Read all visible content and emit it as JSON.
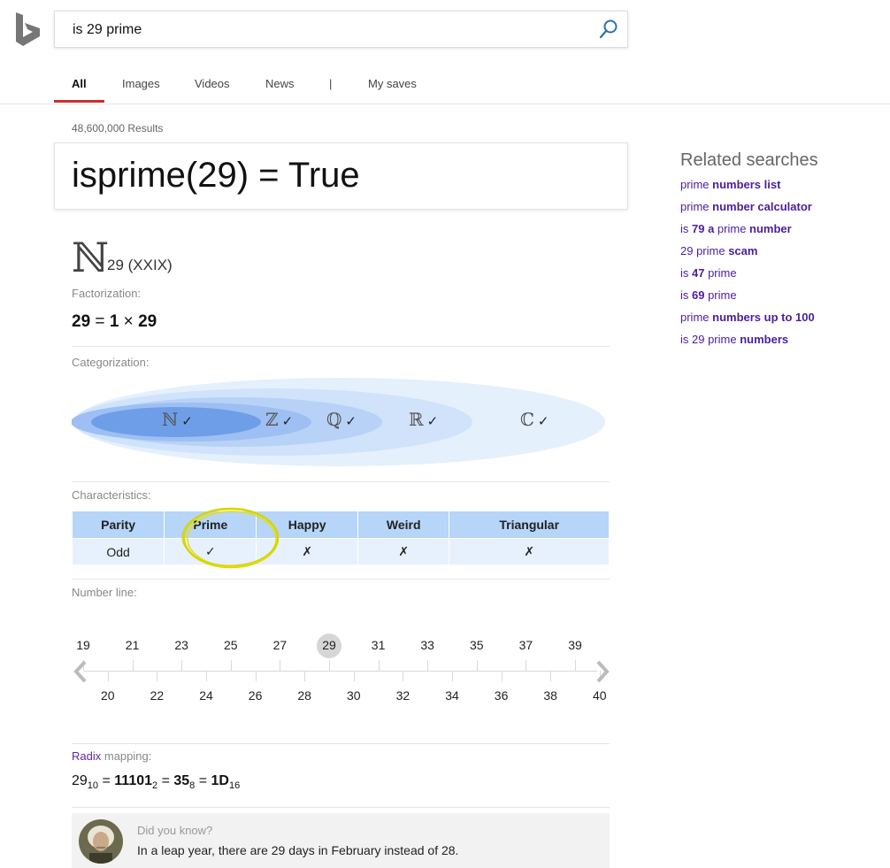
{
  "search": {
    "query": "is 29 prime"
  },
  "tabs": [
    {
      "label": "All"
    },
    {
      "label": "Images"
    },
    {
      "label": "Videos"
    },
    {
      "label": "News"
    },
    {
      "label": "|"
    },
    {
      "label": "My saves"
    }
  ],
  "results_count": "48,600,000 Results",
  "answer": "isprime(29) = True",
  "number_card": {
    "natural_symbol": "ℕ",
    "number": "29 (XXIX)",
    "factorization_label": "Factorization:",
    "factorization": {
      "n": "29",
      "eq": "=",
      "a": "1",
      "times": "×",
      "b": "29"
    },
    "categorization_label": "Categorization:",
    "sets": [
      {
        "symbol": "ℕ",
        "check": "✓"
      },
      {
        "symbol": "ℤ",
        "check": "✓"
      },
      {
        "symbol": "ℚ",
        "check": "✓"
      },
      {
        "symbol": "ℝ",
        "check": "✓"
      },
      {
        "symbol": "ℂ",
        "check": "✓"
      }
    ],
    "characteristics_label": "Characteristics:",
    "characteristics": {
      "headers": [
        "Parity",
        "Prime",
        "Happy",
        "Weird",
        "Triangular"
      ],
      "values": [
        "Odd",
        "✓",
        "✗",
        "✗",
        "✗"
      ]
    },
    "number_line_label": "Number line:",
    "number_line": {
      "top": [
        "19",
        "21",
        "23",
        "25",
        "27",
        "29",
        "31",
        "33",
        "35",
        "37",
        "39"
      ],
      "bottom": [
        "20",
        "22",
        "24",
        "26",
        "28",
        "30",
        "32",
        "34",
        "36",
        "38",
        "40"
      ],
      "highlight": "29"
    },
    "radix_link": "Radix",
    "radix_label": " mapping:",
    "radix": {
      "v1": "29",
      "b1": "10",
      "eq1": " = ",
      "v2": "11101",
      "b2": "2",
      "eq2": " = ",
      "v3": "35",
      "b3": "8",
      "eq3": " = ",
      "v4": "1D",
      "b4": "16"
    },
    "did_you_know": {
      "title": "Did you know?",
      "text": "In a leap year, there are 29 days in February instead of 28."
    }
  },
  "related": {
    "title": "Related searches",
    "items": [
      {
        "a": "prime ",
        "b": "numbers list",
        "c": ""
      },
      {
        "a": "prime ",
        "b": "number calculator",
        "c": ""
      },
      {
        "a": "is ",
        "b": "79 a",
        "c": " prime ",
        "d": "number"
      },
      {
        "a": "29 prime ",
        "b": "scam",
        "c": ""
      },
      {
        "a": "is ",
        "b": "47",
        "c": " prime"
      },
      {
        "a": "is ",
        "b": "69",
        "c": " prime"
      },
      {
        "a": "prime ",
        "b": "numbers up to 100",
        "c": ""
      },
      {
        "a": "is 29 prime ",
        "b": "numbers",
        "c": ""
      }
    ]
  },
  "colors": {
    "accent": "#c8312a",
    "link": "#4b1e9c",
    "table_header": "#b6d5f9",
    "table_cell": "#e6f1fd",
    "highlight_ring": "#dcd800"
  }
}
